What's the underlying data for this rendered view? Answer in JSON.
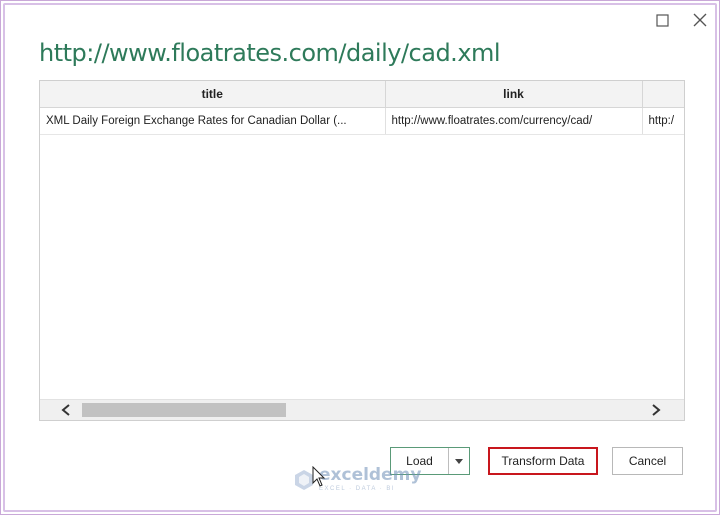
{
  "window": {
    "maximize_icon": "maximize-icon",
    "close_icon": "close-icon"
  },
  "dialog": {
    "title": "http://www.floatrates.com/daily/cad.xml"
  },
  "preview_table": {
    "columns": [
      "title",
      "link",
      ""
    ],
    "rows": [
      [
        "XML Daily Foreign Exchange Rates for Canadian Dollar (...",
        "http://www.floatrates.com/currency/cad/",
        "http:/"
      ]
    ]
  },
  "buttons": {
    "load": "Load",
    "load_dropdown_icon": "caret-down-icon",
    "transform": "Transform Data",
    "cancel": "Cancel"
  },
  "watermark": {
    "name": "exceldemy",
    "tagline": "EXCEL · DATA · BI"
  },
  "colors": {
    "title": "#2e7a5a",
    "highlight_border": "#c8161d",
    "load_border": "#5a9a78"
  }
}
